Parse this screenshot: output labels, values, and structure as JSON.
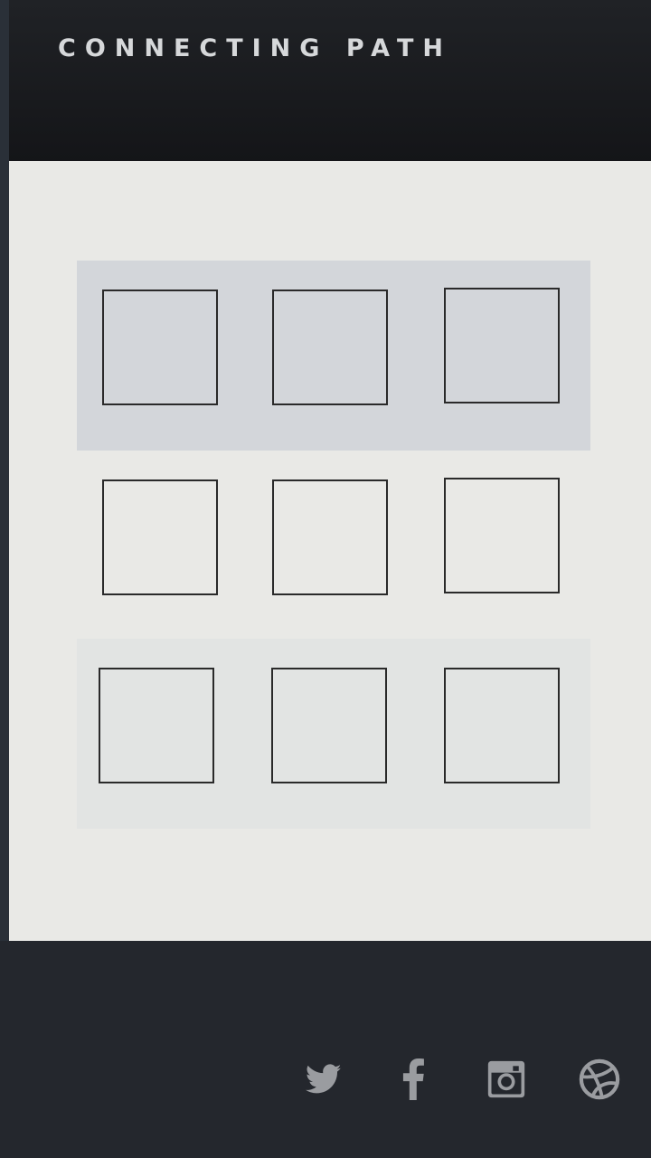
{
  "header": {
    "title": "CONNECTING PATH"
  },
  "grid": {
    "rows": 3,
    "columns": 3,
    "highlighted_row": 1
  },
  "footer": {
    "social_icons": [
      "twitter-icon",
      "facebook-icon",
      "instagram-icon",
      "dribbble-icon"
    ]
  },
  "colors": {
    "header_bg": "#18191c",
    "content_bg": "#e9e9e6",
    "highlight_row_bg": "#d3d6da",
    "cell_border": "#2a2a2a",
    "footer_bg": "#24272d",
    "icon_color": "#9a9ca0",
    "title_color": "#d6d8da"
  }
}
